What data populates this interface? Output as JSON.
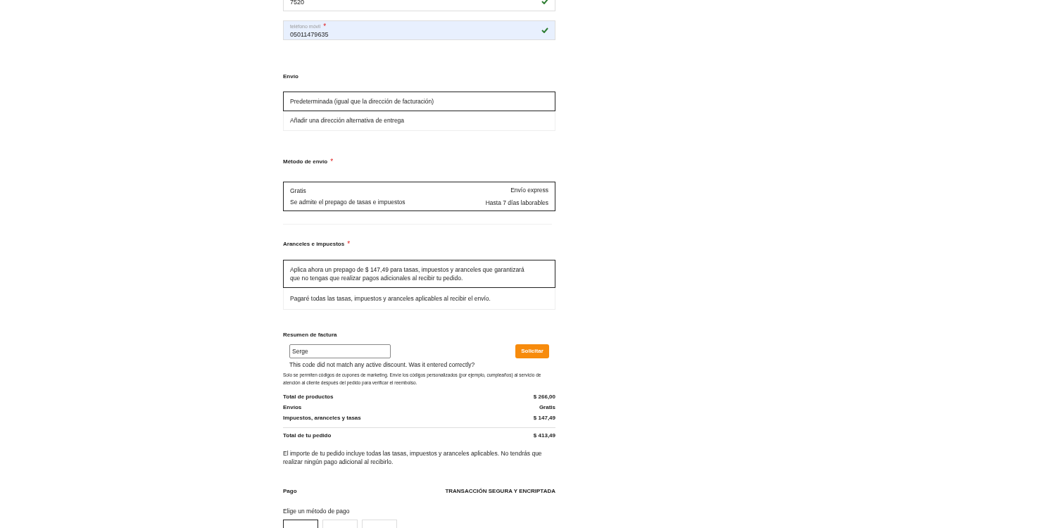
{
  "fields": [
    {
      "value": "7520",
      "valid": true,
      "focused": false
    },
    {
      "label": "teléfono móvil",
      "required_mark": "*",
      "value": "05011479635",
      "valid": true,
      "focused": true
    }
  ],
  "shipping": {
    "title": "Envío",
    "options": [
      {
        "label": "Predeterminada (igual que la dirección de facturación)",
        "selected": true
      },
      {
        "label": "Añadir una dirección alternativa de entrega",
        "selected": false
      }
    ]
  },
  "shipping_method": {
    "title": "Método de envío",
    "required_mark": "*",
    "option": {
      "price": "Gratis",
      "note": "Se admite el prepago de tasas e impuestos",
      "name": "Envío express",
      "eta": "Hasta 7 días laborables",
      "selected": true
    }
  },
  "duties": {
    "title": "Aranceles e impuestos",
    "required_mark": "*",
    "options": [
      {
        "label": "Aplica ahora un prepago de $ 147,49 para tasas, impuestos y aranceles que garantizará que no tengas que realizar pagos adicionales al recibir tu pedido.",
        "selected": true
      },
      {
        "label": "Pagaré todas las tasas, impuestos y aranceles aplicables al recibir el envío.",
        "selected": false
      }
    ]
  },
  "summary": {
    "title": "Resumen de factura",
    "coupon": {
      "value": "Serge",
      "button": "Solicitar",
      "error": "This code did not match any active discount. Was it entered correctly?",
      "note": "Solo se permiten códigos de cupones de marketing. Envíe los códigos personalizados (por ejemplo, cumpleaños) al servicio de atención al cliente después del pedido para verificar el reembolso."
    },
    "lines": [
      {
        "label": "Total de productos",
        "value": "$ 266,00"
      },
      {
        "label": "Envíos",
        "value": "Gratis"
      },
      {
        "label": "Impuestos, aranceles y tasas",
        "value": "$ 147,49"
      }
    ],
    "total": {
      "label": "Total de tu pedido",
      "value": "$ 413,49"
    },
    "disclaimer": "El importe de tu pedido incluye todas las tasas, impuestos y aranceles aplicables. No tendrás que realizar ningún pago adicional al recibirlo."
  },
  "payment": {
    "title": "Pago",
    "secure": "TRANSACCIÓN SEGURA Y ENCRIPTADA",
    "prompt": "Elige un método de pago",
    "methods": [
      {
        "selected": true
      },
      {
        "selected": false
      },
      {
        "selected": false
      }
    ]
  }
}
